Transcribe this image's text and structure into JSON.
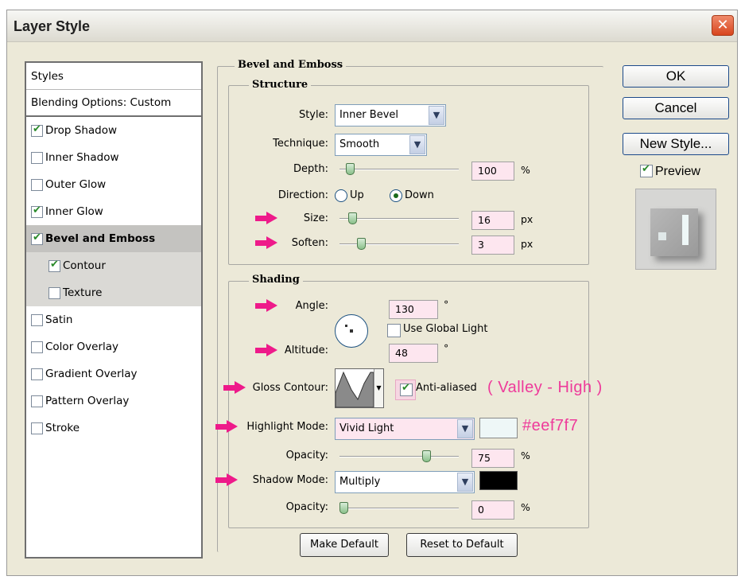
{
  "window": {
    "title": "Layer Style",
    "close_icon": "close-icon"
  },
  "styles_list": {
    "header": "Styles",
    "blending": "Blending Options: Custom",
    "items": [
      {
        "label": "Drop Shadow",
        "checked": true
      },
      {
        "label": "Inner Shadow",
        "checked": false
      },
      {
        "label": "Outer Glow",
        "checked": false
      },
      {
        "label": "Inner Glow",
        "checked": true
      },
      {
        "label": "Bevel and Emboss",
        "checked": true,
        "active": true
      },
      {
        "label": "Contour",
        "checked": true,
        "sub": true
      },
      {
        "label": "Texture",
        "checked": false,
        "sub": true
      },
      {
        "label": "Satin",
        "checked": false
      },
      {
        "label": "Color Overlay",
        "checked": false
      },
      {
        "label": "Gradient Overlay",
        "checked": false
      },
      {
        "label": "Pattern Overlay",
        "checked": false
      },
      {
        "label": "Stroke",
        "checked": false
      }
    ]
  },
  "bevel": {
    "section_title": "Bevel and Emboss",
    "structure": {
      "title": "Structure",
      "style_label": "Style:",
      "style_value": "Inner Bevel",
      "technique_label": "Technique:",
      "technique_value": "Smooth",
      "depth_label": "Depth:",
      "depth_value": "100",
      "depth_unit": "%",
      "depth_slider": 0.06,
      "direction_label": "Direction:",
      "dir_up": "Up",
      "dir_down": "Down",
      "direction_selected": "Down",
      "size_label": "Size:",
      "size_value": "16",
      "size_unit": "px",
      "size_slider": 0.08,
      "soften_label": "Soften:",
      "soften_value": "3",
      "soften_unit": "px",
      "soften_slider": 0.16
    },
    "shading": {
      "title": "Shading",
      "angle_label": "Angle:",
      "angle_value": "130",
      "angle_unit": "°",
      "global_light_label": "Use Global Light",
      "global_light_checked": false,
      "altitude_label": "Altitude:",
      "altitude_value": "48",
      "altitude_unit": "°",
      "gloss_label": "Gloss Contour:",
      "anti_aliased_label": "Anti-aliased",
      "anti_aliased_checked": true,
      "highlight_label": "Highlight Mode:",
      "highlight_value": "Vivid Light",
      "highlight_color": "#eef7f7",
      "opacity1_label": "Opacity:",
      "opacity1_value": "75",
      "opacity1_unit": "%",
      "opacity1_slider": 0.75,
      "shadow_label": "Shadow Mode:",
      "shadow_value": "Multiply",
      "shadow_color": "#000000",
      "opacity2_label": "Opacity:",
      "opacity2_value": "0",
      "opacity2_unit": "%",
      "opacity2_slider": 0.0
    },
    "make_default": "Make Default",
    "reset_default": "Reset to Default"
  },
  "annotations": {
    "contour_note": "( Valley - High )",
    "color_note": "#eef7f7"
  },
  "buttons": {
    "ok": "OK",
    "cancel": "Cancel",
    "new_style": "New Style...",
    "preview_label": "Preview",
    "preview_checked": true
  },
  "colors": {
    "accent_pink": "#ee1a8a",
    "field_pink": "#fde6ef"
  }
}
